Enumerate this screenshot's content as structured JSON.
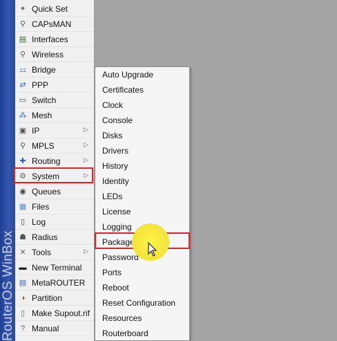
{
  "app": {
    "vertical_title": "RouterOS WinBox"
  },
  "main_menu": [
    {
      "label": "Quick Set",
      "icon": "wand-icon",
      "has_submenu": false
    },
    {
      "label": "CAPsMAN",
      "icon": "antenna-icon",
      "has_submenu": false
    },
    {
      "label": "Interfaces",
      "icon": "interfaces-icon",
      "has_submenu": false
    },
    {
      "label": "Wireless",
      "icon": "wireless-icon",
      "has_submenu": false
    },
    {
      "label": "Bridge",
      "icon": "bridge-icon",
      "has_submenu": false
    },
    {
      "label": "PPP",
      "icon": "ppp-icon",
      "has_submenu": false
    },
    {
      "label": "Switch",
      "icon": "switch-icon",
      "has_submenu": false
    },
    {
      "label": "Mesh",
      "icon": "mesh-icon",
      "has_submenu": false
    },
    {
      "label": "IP",
      "icon": "ip-icon",
      "has_submenu": true
    },
    {
      "label": "MPLS",
      "icon": "mpls-icon",
      "has_submenu": true
    },
    {
      "label": "Routing",
      "icon": "routing-icon",
      "has_submenu": true
    },
    {
      "label": "System",
      "icon": "gear-icon",
      "has_submenu": true
    },
    {
      "label": "Queues",
      "icon": "queues-icon",
      "has_submenu": false
    },
    {
      "label": "Files",
      "icon": "folder-icon",
      "has_submenu": false
    },
    {
      "label": "Log",
      "icon": "log-icon",
      "has_submenu": false
    },
    {
      "label": "Radius",
      "icon": "radius-icon",
      "has_submenu": false
    },
    {
      "label": "Tools",
      "icon": "tools-icon",
      "has_submenu": true
    },
    {
      "label": "New Terminal",
      "icon": "terminal-icon",
      "has_submenu": false
    },
    {
      "label": "MetaROUTER",
      "icon": "metarouter-icon",
      "has_submenu": false
    },
    {
      "label": "Partition",
      "icon": "partition-icon",
      "has_submenu": false
    },
    {
      "label": "Make Supout.rif",
      "icon": "document-icon",
      "has_submenu": false
    },
    {
      "label": "Manual",
      "icon": "help-icon",
      "has_submenu": false
    }
  ],
  "system_submenu": [
    "Auto Upgrade",
    "Certificates",
    "Clock",
    "Console",
    "Disks",
    "Drivers",
    "History",
    "Identity",
    "LEDs",
    "License",
    "Logging",
    "Packages",
    "Password",
    "Ports",
    "Reboot",
    "Reset Configuration",
    "Resources",
    "Routerboard"
  ],
  "colors": {
    "highlight_box": "#d9252a",
    "strip": "#2a4aa2",
    "cursor_highlight": "#f4e53a"
  }
}
